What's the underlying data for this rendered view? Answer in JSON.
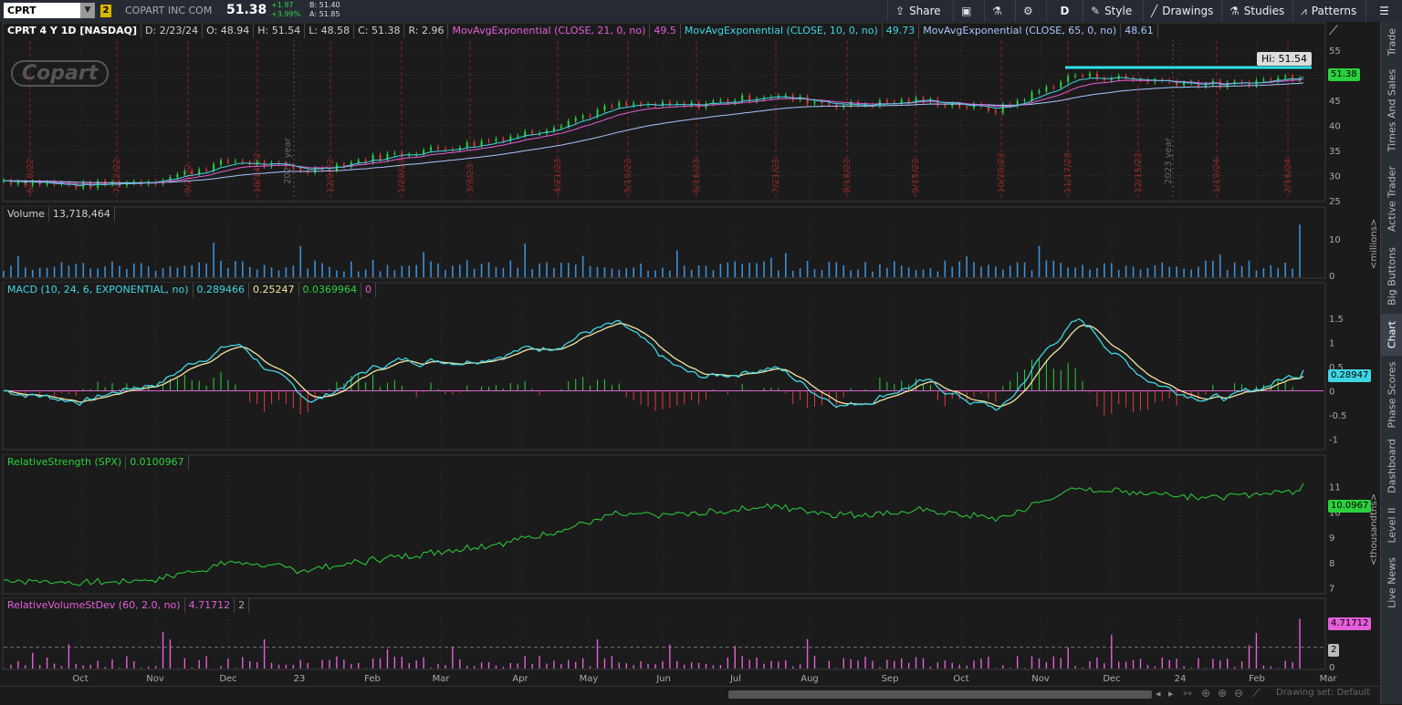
{
  "toolbar": {
    "symbol": "CPRT",
    "link_badge": "2",
    "company": "COPART INC COM",
    "last": "51.38",
    "change": "+1.97",
    "change_pct": "+3.99%",
    "bid": "B: 51.40",
    "ask": "A: 51.85",
    "share": "Share",
    "aggregation": "D",
    "style": "Style",
    "drawings": "Drawings",
    "studies": "Studies",
    "patterns": "Patterns"
  },
  "price_pane": {
    "symbol_label": "CPRT 4 Y 1D [NASDAQ]",
    "date": "D: 2/23/24",
    "open": "O: 48.94",
    "high": "H: 51.54",
    "low": "L: 48.58",
    "close": "C: 51.38",
    "range": "R: 2.96",
    "ema21_label": "MovAvgExponential (CLOSE, 21, 0, no)",
    "ema21_val": "49.5",
    "ema10_label": "MovAvgExponential (CLOSE, 10, 0, no)",
    "ema10_val": "49.73",
    "ema65_label": "MovAvgExponential (CLOSE, 65, 0, no)",
    "ema65_val": "48.61",
    "logo_text": "Copart",
    "hi_label": "Hi: 51.54",
    "price_tag": "51.38",
    "year_2022": "2022 year",
    "year_2023": "2023 year",
    "yticks": [
      "55",
      "50",
      "45",
      "40",
      "35",
      "30",
      "25"
    ],
    "marker_dates": [
      "6/10/22",
      "7/22/22",
      "9/2/22",
      "10/14/22",
      "12/9/22",
      "1/20/23",
      "3/3/23",
      "4/21/23",
      "5/19/23",
      "6/16/23",
      "7/21/23",
      "8/18/23",
      "9/15/23",
      "10/20/23",
      "11/17/23",
      "12/15/23",
      "1/19/24",
      "2/16/24"
    ]
  },
  "volume_pane": {
    "label": "Volume",
    "value": "13,718,464",
    "ytick": "10",
    "ytick0": "0",
    "unit": "<millions>"
  },
  "macd_pane": {
    "label": "MACD (10, 24, 6, EXPONENTIAL, no)",
    "v1": "0.289466",
    "v2": "0.25247",
    "v3": "0.0369964",
    "v4": "0",
    "tag": "0.28947",
    "yticks": [
      "1.5",
      "1",
      "0.5",
      "0",
      "-0.5",
      "-1"
    ]
  },
  "rs_pane": {
    "label": "RelativeStrength (SPX)",
    "value": "0.0100967",
    "tag": "10.0967",
    "yticks": [
      "11",
      "10",
      "9",
      "8",
      "7"
    ],
    "unit": "<thousandths>"
  },
  "rv_pane": {
    "label": "RelativeVolumeStDev (60, 2.0, no)",
    "value": "4.71712",
    "extra": "2",
    "tag": "4.71712",
    "tag2": "2",
    "ytick4": "4",
    "ytick0": "0"
  },
  "x_axis": [
    "Oct",
    "Nov",
    "Dec",
    "23",
    "Feb",
    "Mar",
    "Apr",
    "May",
    "Jun",
    "Jul",
    "Aug",
    "Sep",
    "Oct",
    "Nov",
    "Dec",
    "24",
    "Feb",
    "Mar"
  ],
  "sidebar": [
    "Trade",
    "Times And Sales",
    "Active Trader",
    "Big Buttons",
    "Chart",
    "Phase Scores",
    "Dashboard",
    "Level II",
    "Live News"
  ],
  "footer": {
    "drawing_set": "Drawing set: Default"
  },
  "chart_data": {
    "type": "line",
    "panes": [
      "price",
      "volume",
      "macd",
      "relative_strength",
      "relative_volume_stdev"
    ],
    "x": [
      "Sep",
      "Oct",
      "Nov",
      "Dec",
      "23",
      "Feb",
      "Mar",
      "Apr",
      "May",
      "Jun",
      "Jul",
      "Aug",
      "Sep",
      "Oct",
      "Nov",
      "Dec",
      "24",
      "Feb"
    ],
    "price_close": [
      29,
      28,
      29,
      33,
      31,
      34,
      36,
      39,
      44,
      44,
      46,
      44,
      45,
      43,
      50,
      49,
      48,
      50
    ],
    "ylim_price": [
      25,
      57
    ]
  }
}
